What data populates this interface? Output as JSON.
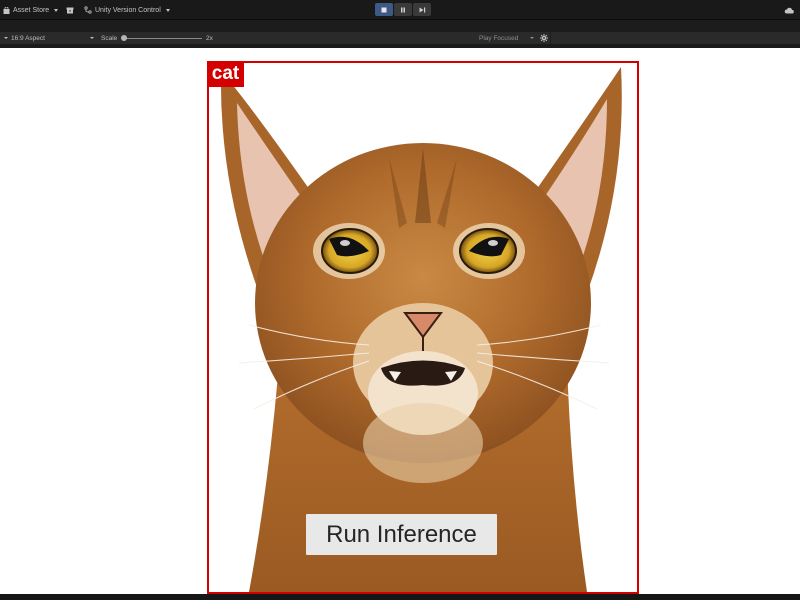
{
  "toolbar": {
    "asset_store_label": "Asset Store",
    "version_control_label": "Unity Version Control",
    "icons": [
      "shopping-bag-icon",
      "package-icon",
      "version-control-icon",
      "stop-icon",
      "pause-icon",
      "step-icon",
      "cloud-icon"
    ]
  },
  "game_view": {
    "aspect_label": "16:9 Aspect",
    "scale_label": "Scale",
    "scale_value": "2x",
    "play_mode_label": "Play Focused"
  },
  "detection": {
    "label": "cat",
    "box_color": "#d40000"
  },
  "run_button": {
    "label": "Run Inference"
  },
  "colors": {
    "toolbar_bg": "#191919",
    "active_play_button": "#3d5a86"
  }
}
